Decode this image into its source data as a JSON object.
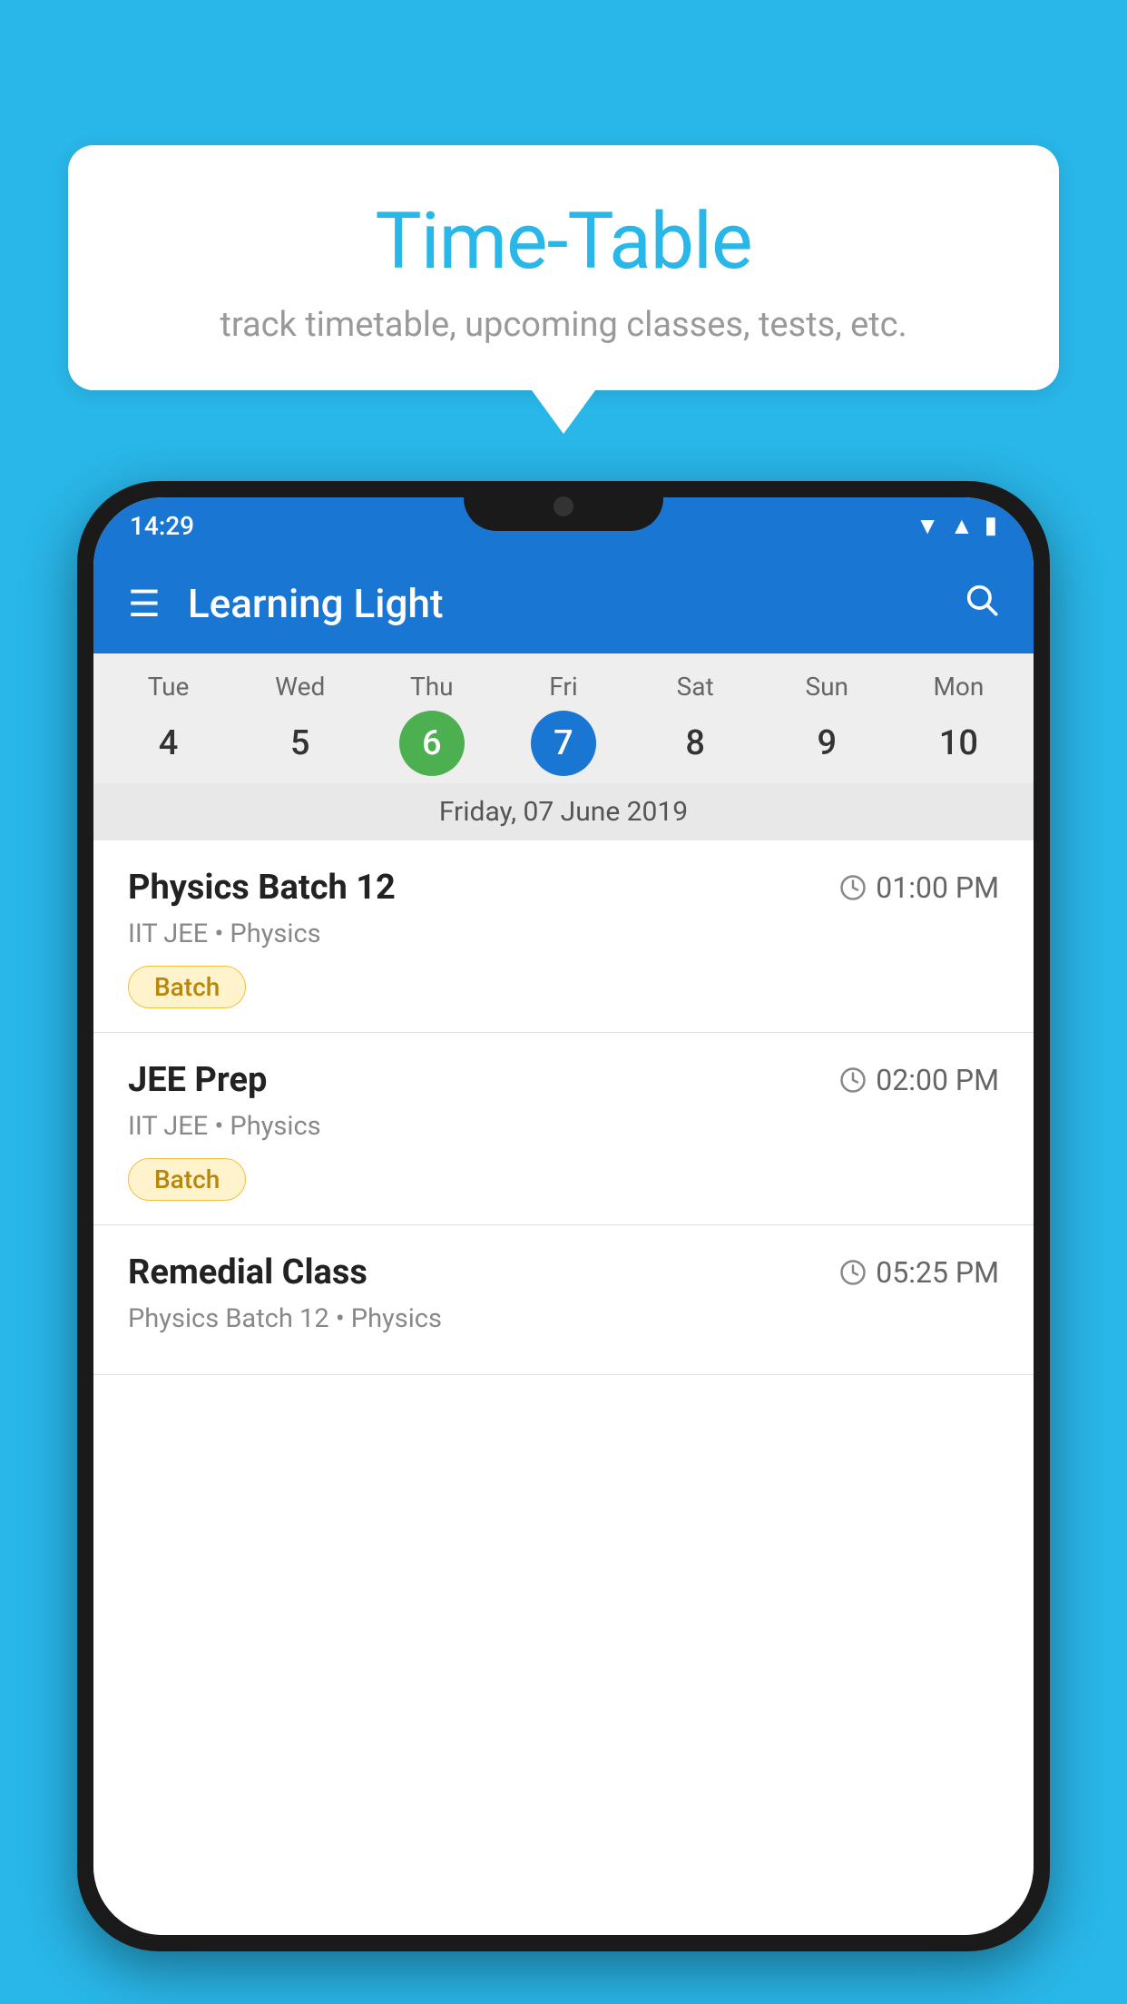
{
  "background_color": "#29b6e8",
  "speech_bubble": {
    "title": "Time-Table",
    "subtitle": "track timetable, upcoming classes, tests, etc."
  },
  "app": {
    "status_bar": {
      "time": "14:29"
    },
    "app_bar": {
      "title": "Learning Light",
      "hamburger_icon": "☰",
      "search_icon": "🔍"
    },
    "calendar": {
      "days": [
        {
          "label": "Tue",
          "number": "4",
          "state": "normal"
        },
        {
          "label": "Wed",
          "number": "5",
          "state": "normal"
        },
        {
          "label": "Thu",
          "number": "6",
          "state": "today"
        },
        {
          "label": "Fri",
          "number": "7",
          "state": "selected"
        },
        {
          "label": "Sat",
          "number": "8",
          "state": "normal"
        },
        {
          "label": "Sun",
          "number": "9",
          "state": "normal"
        },
        {
          "label": "Mon",
          "number": "10",
          "state": "normal"
        }
      ],
      "selected_date_label": "Friday, 07 June 2019"
    },
    "classes": [
      {
        "name": "Physics Batch 12",
        "time": "01:00 PM",
        "meta": "IIT JEE • Physics",
        "badge": "Batch"
      },
      {
        "name": "JEE Prep",
        "time": "02:00 PM",
        "meta": "IIT JEE • Physics",
        "badge": "Batch"
      },
      {
        "name": "Remedial Class",
        "time": "05:25 PM",
        "meta": "Physics Batch 12 • Physics",
        "badge": null
      }
    ]
  }
}
